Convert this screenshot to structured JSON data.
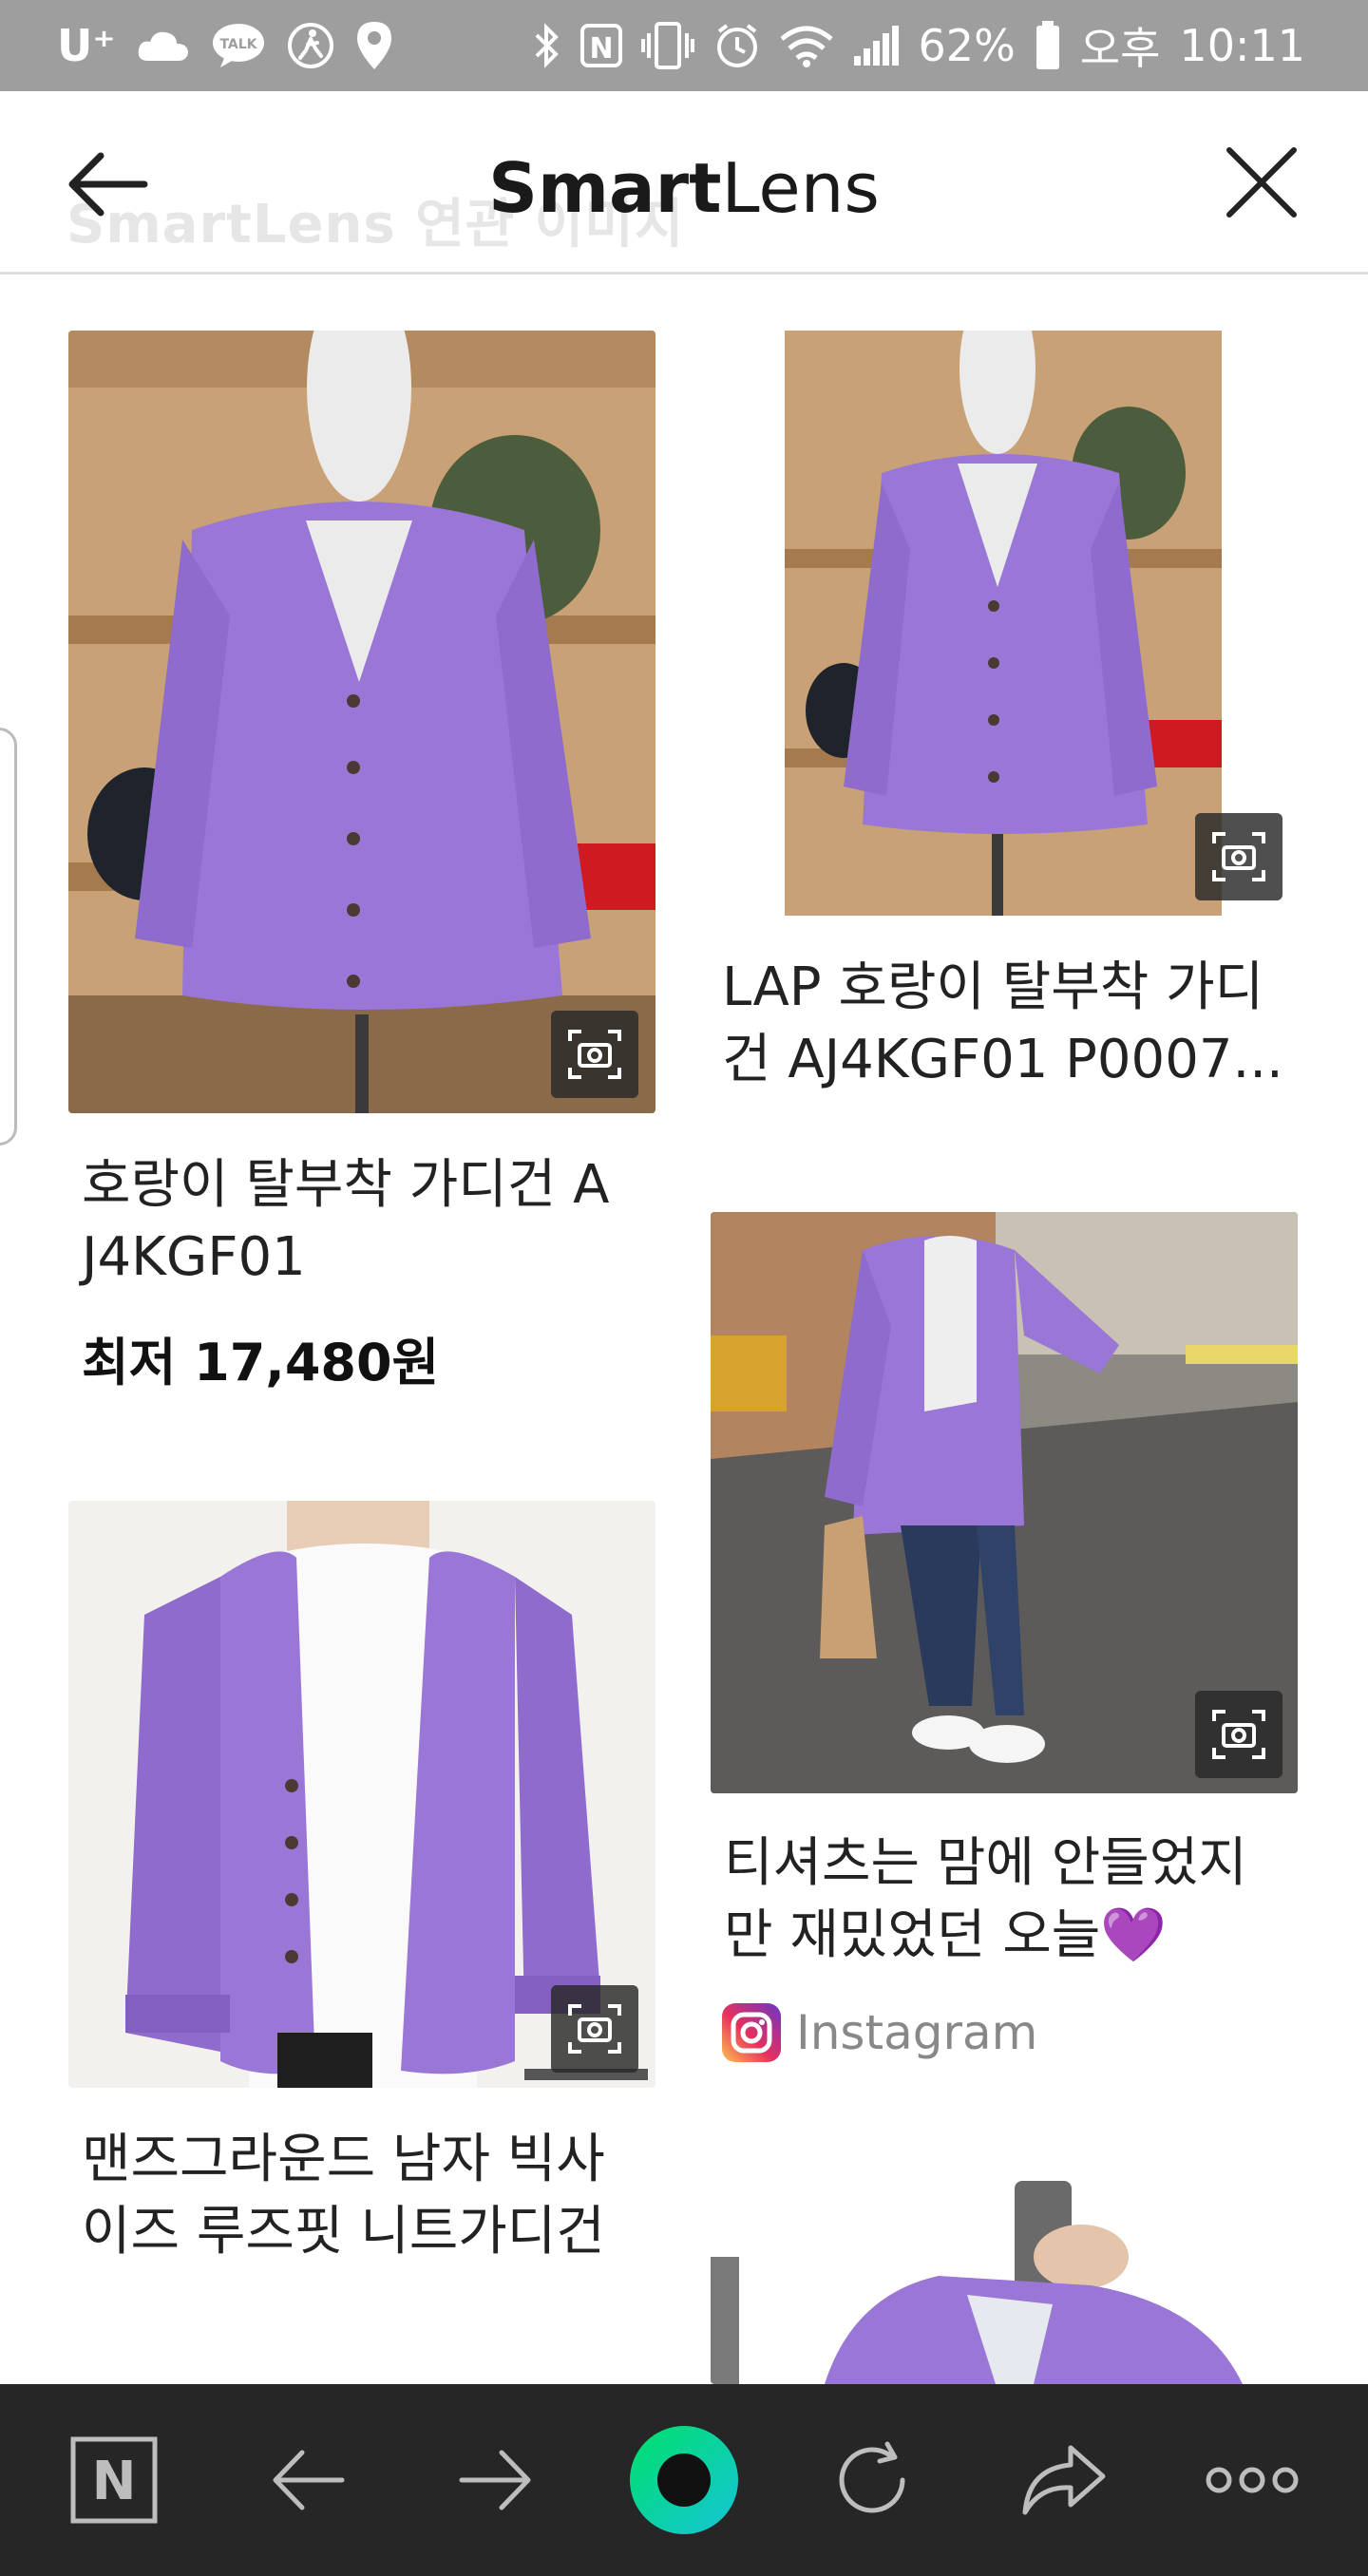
{
  "status_bar": {
    "carrier": "U⁺",
    "battery_percent": "62%",
    "time_period": "오후",
    "time": "10:11",
    "icons": [
      "cloud-icon",
      "kakaotalk-icon",
      "walk-icon",
      "location-icon",
      "bluetooth-icon",
      "nfc-icon",
      "vibrate-icon",
      "alarm-icon",
      "wifi-icon",
      "signal-icon",
      "battery-icon"
    ]
  },
  "header": {
    "title_bold": "Smart",
    "title_light": "Lens",
    "behind_text": "SmartLens 연관 이미지",
    "back_icon": "arrow-left-icon",
    "close_icon": "close-icon"
  },
  "results": {
    "left": [
      {
        "title": "호랑이 탈부착 가디건 AJ4KGF01",
        "title_line1": "호랑이 탈부착 가디건 A",
        "title_line2": "J4KGF01",
        "price": "최저 17,480원"
      },
      {
        "title_line1": "맨즈그라운드 남자 빅사",
        "title_line2": "이즈 루즈핏 니트가디건"
      }
    ],
    "right": [
      {
        "title_line1": "LAP 호랑이 탈부착 가디",
        "title_line2": "건 AJ4KGF01 P0007..."
      },
      {
        "title_line1": "티셔츠는 맘에 안들었지",
        "title_line2": "만 재밌었던 오늘💜",
        "source": "Instagram"
      },
      {}
    ]
  },
  "bottom_bar": {
    "items": [
      "naver-home-icon",
      "back-icon",
      "forward-icon",
      "greendot-icon",
      "refresh-icon",
      "share-icon",
      "more-icon"
    ]
  },
  "colors": {
    "accent_green": "#00c73c",
    "cardigan_purple": "#9a77d6",
    "status_bar_bg": "#9e9e9e",
    "bottom_bar_bg": "#262626"
  }
}
